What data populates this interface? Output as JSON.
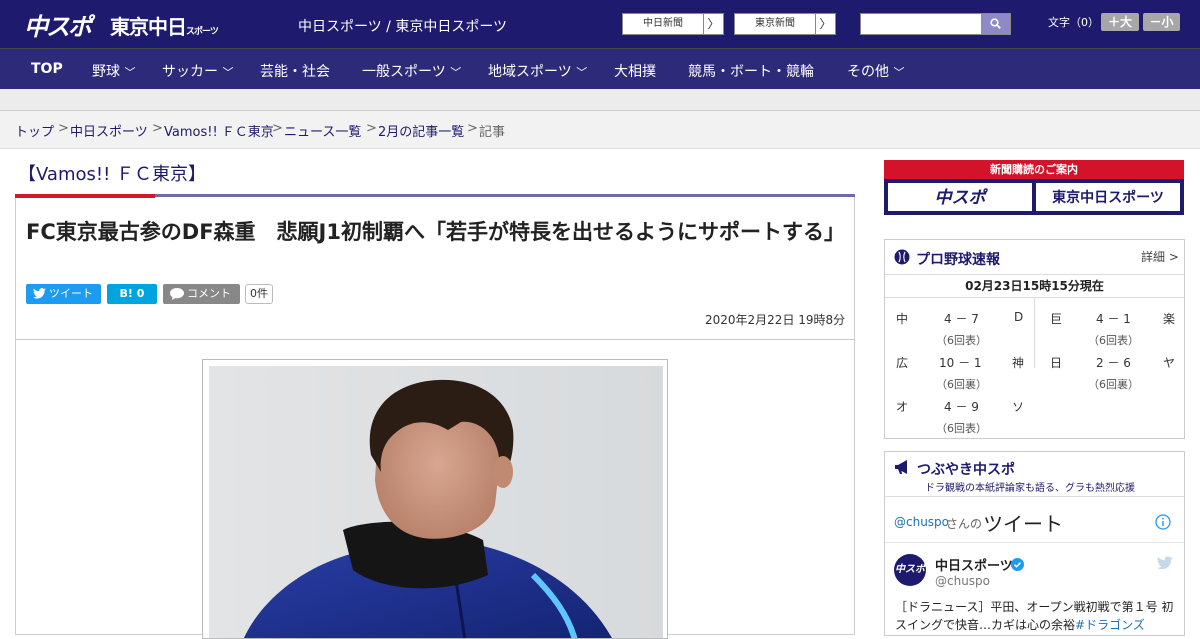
{
  "header": {
    "logo_main": "中スポ",
    "logo_sub": "東京中日",
    "logo_sub_small": "スポーツ",
    "site_name": "中日スポーツ / 東京中日スポーツ",
    "paper1": "中日新聞",
    "paper2": "東京新聞",
    "arrow": "〉",
    "font_label": "文字（0）",
    "font_up": "＋大",
    "font_down": "－小",
    "search_placeholder": ""
  },
  "nav": {
    "items": [
      {
        "label": "TOP"
      },
      {
        "label": "野球",
        "chev": "﹀"
      },
      {
        "label": "サッカー",
        "chev": "﹀"
      },
      {
        "label": "芸能・社会"
      },
      {
        "label": "一般スポーツ",
        "chev": "﹀"
      },
      {
        "label": "地域スポーツ",
        "chev": "﹀"
      },
      {
        "label": "大相撲"
      },
      {
        "label": "競馬・ボート・競輪"
      },
      {
        "label": "その他",
        "chev": "﹀"
      }
    ]
  },
  "breadcrumb": {
    "items": [
      "トップ",
      "中日スポーツ",
      "Vamos!! ＦＣ東京",
      "ニュース一覧",
      "2月の記事一覧"
    ],
    "current": "記事",
    "sep": ">"
  },
  "article": {
    "section": "【Vamos!! ＦＣ東京】",
    "title": "FC東京最古参のDF森重　悲願J1初制覇へ「若手が特長を出せるようにサポートする」",
    "tweet": "ツイート",
    "hatena": "B! 0",
    "comment": "コメント",
    "comment_count": "0件",
    "date": "2020年2月22日 19時8分"
  },
  "sidebar": {
    "ad": {
      "title": "新聞購読のご案内",
      "btn1": "中スポ",
      "btn2": "東京中日スポーツ"
    },
    "baseball": {
      "title": "プロ野球速報",
      "detail": "詳細 >",
      "updated": "02月23日15時15分現在",
      "games": [
        {
          "home": "中",
          "score": "4 － 7",
          "away": "D",
          "inning": "（6回表）"
        },
        {
          "home": "巨",
          "score": "4 － 1",
          "away": "楽",
          "inning": "（6回表）"
        },
        {
          "home": "広",
          "score": "10 － 1",
          "away": "神",
          "inning": "（6回裏）"
        },
        {
          "home": "日",
          "score": "2 － 6",
          "away": "ヤ",
          "inning": "（6回裏）"
        },
        {
          "home": "オ",
          "score": "4 － 9",
          "away": "ソ",
          "inning": "（6回表）"
        }
      ]
    },
    "tsubuyaki": {
      "title": "つぶやき中スポ",
      "subtitle": "ドラ観戦の本紙評論家も語る、グラも熱烈応援",
      "handle": "@chuspo",
      "handle_suffix": "さんの",
      "tweets_label": "ツイート",
      "account_name": "中日スポーツ",
      "account_handle": "@chuspo",
      "tweet_text_1": "［ドラニュース］平田、オープン戦初戦で第１号 初",
      "tweet_text_2": "スイングで快音…カギは心の余裕",
      "hashtag": "#ドラゴンズ"
    }
  },
  "colors": {
    "navy": "#1e1a6d",
    "red": "#cf1a2a",
    "twitter": "#1d9bf0",
    "hatena": "#00a4de"
  }
}
